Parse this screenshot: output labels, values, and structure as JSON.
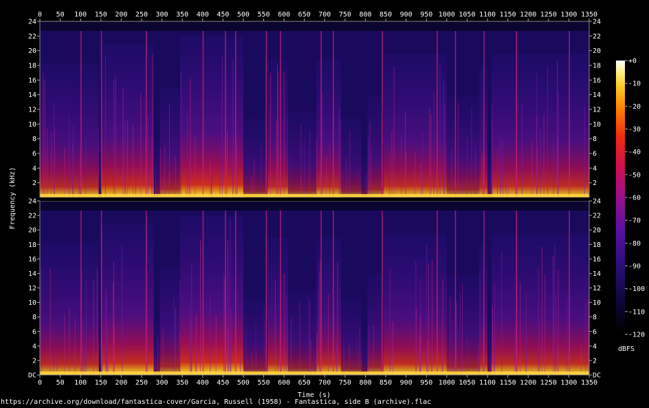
{
  "chart_data": {
    "type": "heatmap",
    "xlabel": "Time (s)",
    "ylabel": "Frequency (kHz)",
    "x_ticks": [
      0,
      50,
      100,
      150,
      200,
      250,
      300,
      350,
      400,
      450,
      500,
      550,
      600,
      650,
      700,
      750,
      800,
      850,
      900,
      950,
      1000,
      1050,
      1100,
      1150,
      1200,
      1250,
      1300,
      1350
    ],
    "xlim": [
      0,
      1350
    ],
    "channels": [
      {
        "y_ticks": [
          "24",
          "22",
          "20",
          "18",
          "16",
          "14",
          "12",
          "10",
          "8",
          "6",
          "4",
          "2"
        ],
        "ylim": [
          0,
          24
        ]
      },
      {
        "y_ticks": [
          "24",
          "22",
          "20",
          "18",
          "16",
          "14",
          "12",
          "10",
          "8",
          "6",
          "4",
          "2",
          "DC"
        ],
        "ylim": [
          0,
          24
        ]
      }
    ],
    "colorbar": {
      "label": "dBFS",
      "ticks": [
        "+0",
        "-10",
        "-20",
        "-30",
        "-40",
        "-50",
        "-60",
        "-70",
        "-80",
        "-90",
        "-100",
        "-110",
        "-120"
      ],
      "range": [
        -120,
        0
      ]
    },
    "segments": [
      {
        "start": 0,
        "end": 145,
        "level": 0.72
      },
      {
        "start": 150,
        "end": 280,
        "level": 0.85
      },
      {
        "start": 282,
        "end": 295,
        "level": 0.2
      },
      {
        "start": 295,
        "end": 345,
        "level": 0.55
      },
      {
        "start": 345,
        "end": 500,
        "level": 0.9
      },
      {
        "start": 500,
        "end": 560,
        "level": 0.35
      },
      {
        "start": 560,
        "end": 610,
        "level": 0.75
      },
      {
        "start": 610,
        "end": 680,
        "level": 0.4
      },
      {
        "start": 680,
        "end": 740,
        "level": 0.75
      },
      {
        "start": 740,
        "end": 790,
        "level": 0.35
      },
      {
        "start": 790,
        "end": 805,
        "level": 0.1
      },
      {
        "start": 805,
        "end": 845,
        "level": 0.5
      },
      {
        "start": 845,
        "end": 1000,
        "level": 0.78
      },
      {
        "start": 1000,
        "end": 1080,
        "level": 0.5
      },
      {
        "start": 1080,
        "end": 1100,
        "level": 0.7
      },
      {
        "start": 1100,
        "end": 1110,
        "level": 0.15
      },
      {
        "start": 1110,
        "end": 1350,
        "level": 0.78
      }
    ],
    "transients": [
      100,
      150,
      260,
      400,
      455,
      480,
      555,
      590,
      690,
      720,
      840,
      975,
      1020,
      1090,
      1170,
      1300
    ]
  },
  "footer": "https://archive.org/download/fantastica-cover/Garcia, Russell (1958) - Fantastica, side B (archive).flac"
}
